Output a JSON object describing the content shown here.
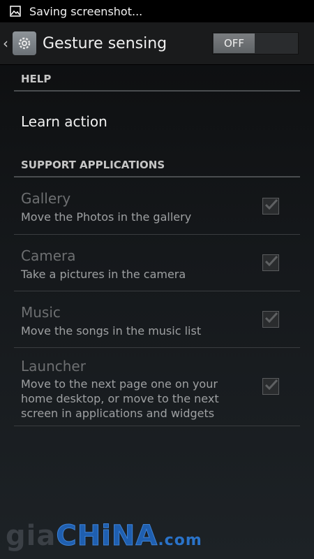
{
  "status_bar": {
    "text": "Saving screenshot..."
  },
  "action_bar": {
    "title": "Gesture sensing",
    "toggle_label": "OFF"
  },
  "sections": {
    "help": "HELP",
    "support": "SUPPORT APPLICATIONS"
  },
  "help_item": {
    "label": "Learn action"
  },
  "apps": [
    {
      "title": "Gallery",
      "summary": "Move the Photos in the gallery",
      "checked": true
    },
    {
      "title": "Camera",
      "summary": "Take a pictures in the camera",
      "checked": true
    },
    {
      "title": "Music",
      "summary": "Move the songs in the music list",
      "checked": true
    },
    {
      "title": "Launcher",
      "summary": "Move to the next page one on your home desktop, or move to the next screen in applications and widgets",
      "checked": true
    }
  ],
  "watermark": {
    "prefix": "gia",
    "main": "CHiNA",
    "suffix": ".com"
  }
}
